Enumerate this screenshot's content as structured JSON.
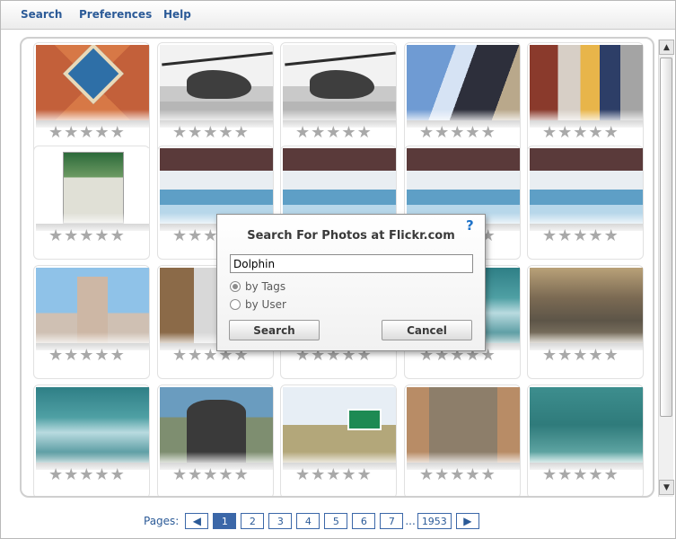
{
  "menu": {
    "items": [
      {
        "label": "Search"
      },
      {
        "label": "Preferences"
      },
      {
        "label": "Help"
      }
    ]
  },
  "grid": {
    "rows": 4,
    "cols": 5,
    "max_rating": 5,
    "photos": [
      {
        "subject": "tile",
        "rating": 0
      },
      {
        "subject": "heli",
        "rating": 0
      },
      {
        "subject": "heli",
        "rating": 0
      },
      {
        "subject": "couple",
        "rating": 0
      },
      {
        "subject": "bench",
        "rating": 0
      },
      {
        "subject": "brochure",
        "rating": 0
      },
      {
        "subject": "arena",
        "rating": 0
      },
      {
        "subject": "arena",
        "rating": 0
      },
      {
        "subject": "arena",
        "rating": 0
      },
      {
        "subject": "arena",
        "rating": 0
      },
      {
        "subject": "castle",
        "rating": 0
      },
      {
        "subject": "man",
        "rating": 0
      },
      {
        "subject": "swim1",
        "rating": 0
      },
      {
        "subject": "swim1",
        "rating": 0
      },
      {
        "subject": "car1",
        "rating": 0
      },
      {
        "subject": "swim1",
        "rating": 0
      },
      {
        "subject": "marker",
        "rating": 0
      },
      {
        "subject": "texas",
        "rating": 0
      },
      {
        "subject": "car2",
        "rating": 0
      },
      {
        "subject": "swim2",
        "rating": 0
      }
    ]
  },
  "pager": {
    "label": "Pages:",
    "prev_icon": "arrow-left-icon",
    "next_icon": "arrow-right-icon",
    "pages": [
      "1",
      "2",
      "3",
      "4",
      "5",
      "6",
      "7"
    ],
    "current": "1",
    "ellipsis": "...",
    "last": "1953"
  },
  "dialog": {
    "title": "Search For Photos at Flickr.com",
    "help_glyph": "?",
    "query": "Dolphin",
    "options": [
      {
        "label": "by Tags",
        "selected": true
      },
      {
        "label": "by User",
        "selected": false
      }
    ],
    "search_label": "Search",
    "cancel_label": "Cancel"
  },
  "colors": {
    "accent": "#2b5a97",
    "pager_border": "#3b67a8",
    "star": "#a9a9a9",
    "help": "#1f73c9"
  }
}
